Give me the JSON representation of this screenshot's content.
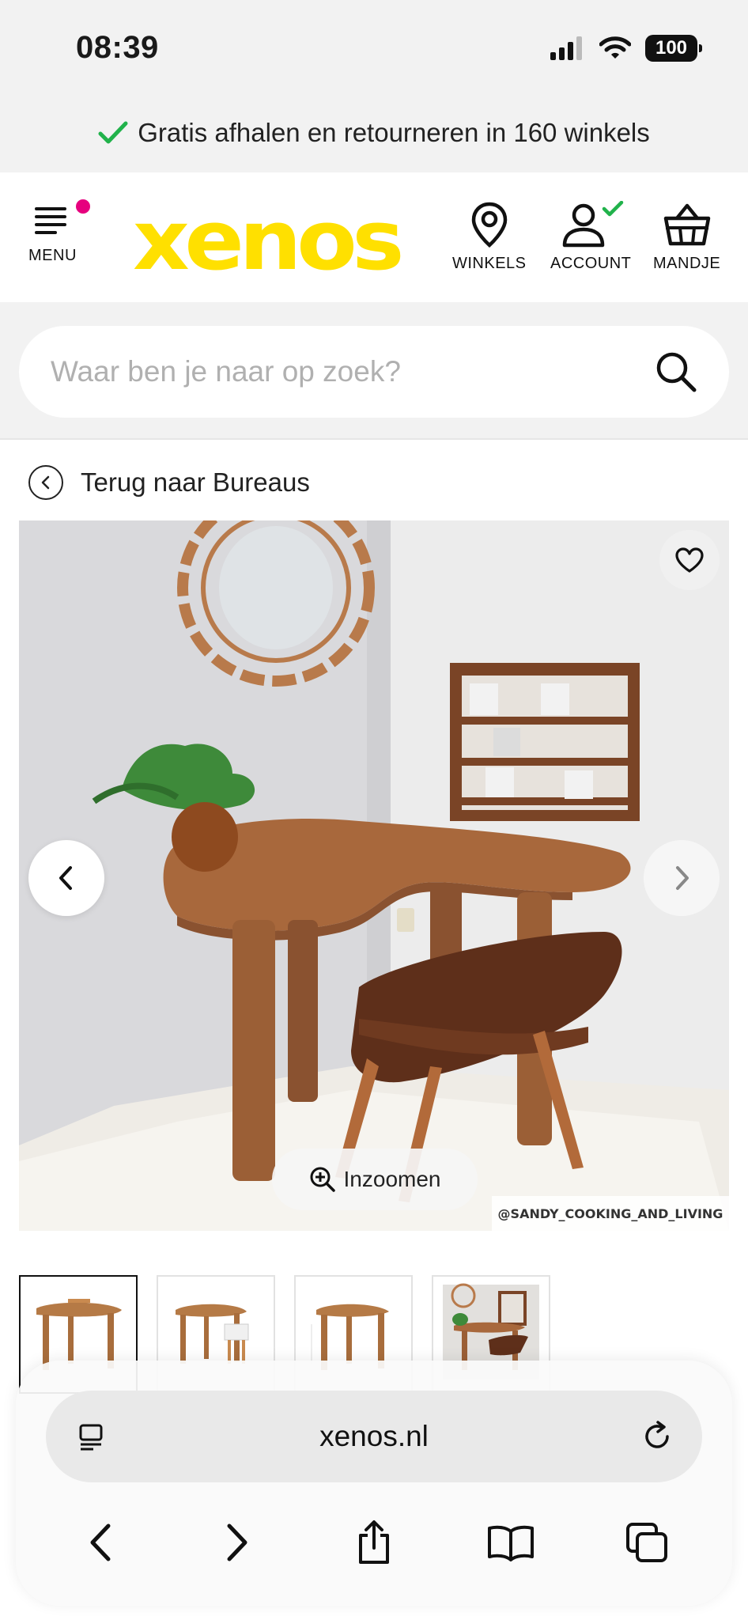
{
  "status": {
    "time": "08:39",
    "battery": "100"
  },
  "promo": {
    "text": "Gratis afhalen en retourneren in 160 winkels"
  },
  "header": {
    "menu_label": "MENU",
    "logo": "xenos",
    "stores_label": "WINKELS",
    "account_label": "ACCOUNT",
    "cart_label": "MANDJE"
  },
  "search": {
    "placeholder": "Waar ben je naar op zoek?"
  },
  "breadcrumb": {
    "back_label": "Terug naar Bureaus"
  },
  "gallery": {
    "zoom_label": "Inzoomen",
    "credit": "@SANDY_COOKING_AND_LIVING",
    "thumbnail_count": 4
  },
  "browser": {
    "url": "xenos.nl"
  },
  "colors": {
    "brand_yellow": "#ffe000",
    "accent_pink": "#e6007e",
    "check_green": "#21b24b"
  }
}
